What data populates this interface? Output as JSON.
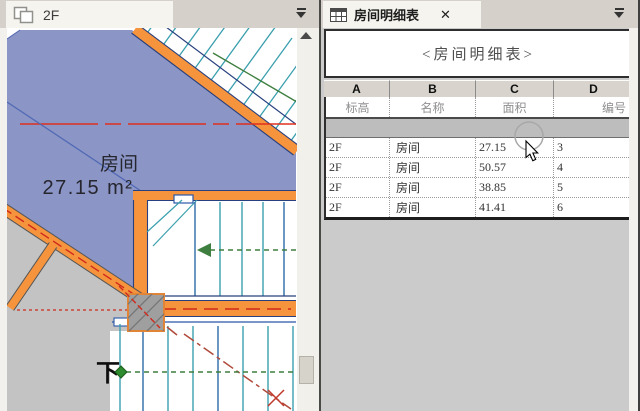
{
  "left_panel": {
    "tab_label": "2F",
    "plan": {
      "room_name": "房间",
      "room_area": "27.15 m²",
      "down_label": "下"
    }
  },
  "right_panel": {
    "tab_label": "房间明细表",
    "close_label": "✕",
    "schedule": {
      "title": "<房间明细表>",
      "letters": [
        "A",
        "B",
        "C",
        "D"
      ],
      "headers": [
        "标高",
        "名称",
        "面积",
        "编号"
      ],
      "rows": [
        [
          "2F",
          "房间",
          "27.15",
          "3"
        ],
        [
          "2F",
          "房间",
          "50.57",
          "4"
        ],
        [
          "2F",
          "房间",
          "38.85",
          "5"
        ],
        [
          "2F",
          "房间",
          "41.41",
          "6"
        ]
      ]
    }
  },
  "colors": {
    "room_fill": "#8b95c6",
    "wall_orange": "#f6943d",
    "edge_navy": "#27407f",
    "tread_teal": "#3a9fae",
    "tread_blue": "#2b6ca8",
    "stair_path_green": "#3e7e3e",
    "reference_red": "#e0301e",
    "centerline_red": "#cf2a1b",
    "exterior_gray": "#c3c3c3",
    "panel_gray": "#cbcbcb"
  }
}
